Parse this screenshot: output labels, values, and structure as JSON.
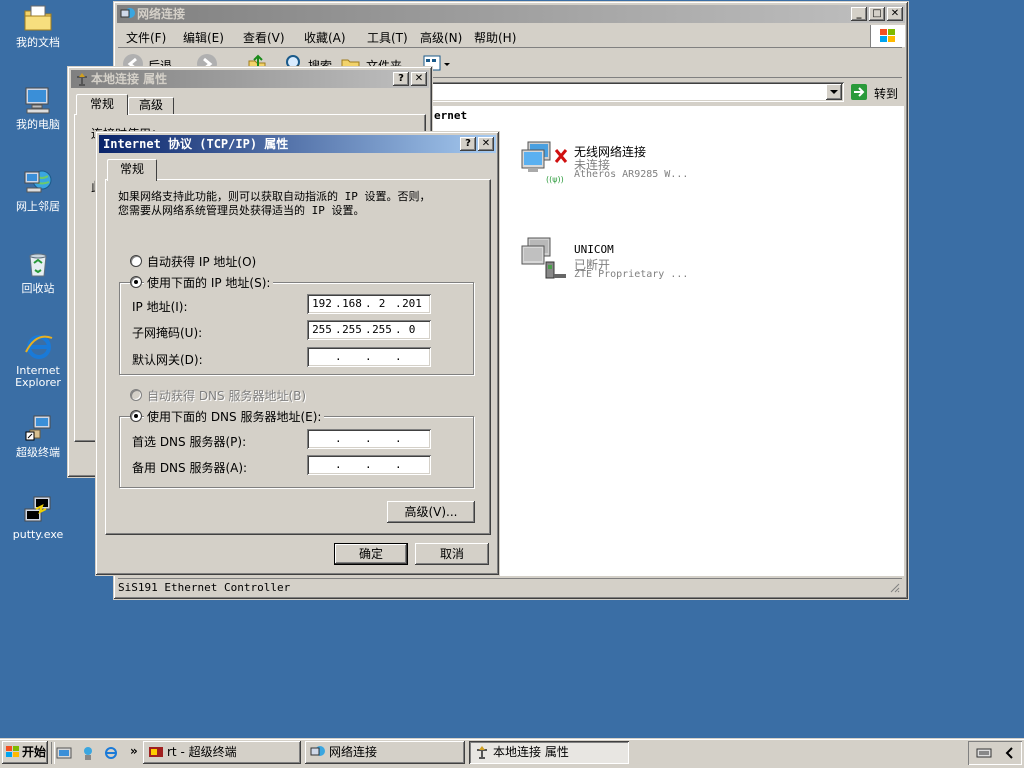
{
  "desktop": {
    "icons": [
      {
        "label": "我的文档"
      },
      {
        "label": "我的电脑"
      },
      {
        "label": "网上邻居"
      },
      {
        "label": "回收站"
      },
      {
        "label": "Internet\nExplorer"
      },
      {
        "label": "超级终端"
      },
      {
        "label": "putty.exe"
      }
    ]
  },
  "network_window": {
    "title": "网络连接",
    "menu": [
      "文件(F)",
      "编辑(E)",
      "查看(V)",
      "收藏(A)",
      "工具(T)",
      "高级(N)",
      "帮助(H)"
    ],
    "toolbar": {
      "back": "后退",
      "search": "搜索",
      "folders": "文件夹"
    },
    "address": {
      "go_label": "转到"
    },
    "section_header": "ernet",
    "connections": [
      {
        "name": "无线网络连接",
        "status": "未连接",
        "device": "Atheros AR9285 W..."
      },
      {
        "name": "UNICOM",
        "status": "已断开",
        "device": "ZTE Proprietary ..."
      }
    ],
    "status_bar": "SiS191 Ethernet Controller",
    "colors": {
      "titlebar_inactive": "#808080",
      "titlebar_active": "#0a246a"
    }
  },
  "lan_props": {
    "title": "本地连接 属性",
    "tabs": [
      "常规",
      "高级"
    ],
    "fragment_connect": "连接时使用：",
    "fragment_this": "此"
  },
  "tcpip_dialog": {
    "title": "Internet 协议 (TCP/IP) 属性",
    "tab": "常规",
    "description": "如果网络支持此功能，则可以获取自动指派的 IP 设置。否则，\n您需要从网络系统管理员处获得适当的 IP 设置。",
    "ip_auto_label": "自动获得 IP 地址(O)",
    "ip_manual_label": "使用下面的 IP 地址(S):",
    "ip_mode": "manual",
    "ip_address_label": "IP 地址(I):",
    "ip_address": [
      "192",
      "168",
      "2",
      "201"
    ],
    "subnet_label": "子网掩码(U):",
    "subnet": [
      "255",
      "255",
      "255",
      "0"
    ],
    "gateway_label": "默认网关(D):",
    "gateway": [
      "",
      "",
      "",
      ""
    ],
    "dns_auto_label": "自动获得 DNS 服务器地址(B)",
    "dns_manual_label": "使用下面的 DNS 服务器地址(E):",
    "dns_mode": "manual",
    "dns_pref_label": "首选 DNS 服务器(P):",
    "dns_pref": [
      "",
      "",
      "",
      ""
    ],
    "dns_alt_label": "备用 DNS 服务器(A):",
    "dns_alt": [
      "",
      "",
      "",
      ""
    ],
    "advanced_button": "高级(V)...",
    "ok_button": "确定",
    "cancel_button": "取消"
  },
  "taskbar": {
    "start": "开始",
    "overflow": "»",
    "tasks": [
      {
        "label": "rt - 超级终端"
      },
      {
        "label": "网络连接"
      },
      {
        "label": "本地连接 属性"
      }
    ]
  }
}
